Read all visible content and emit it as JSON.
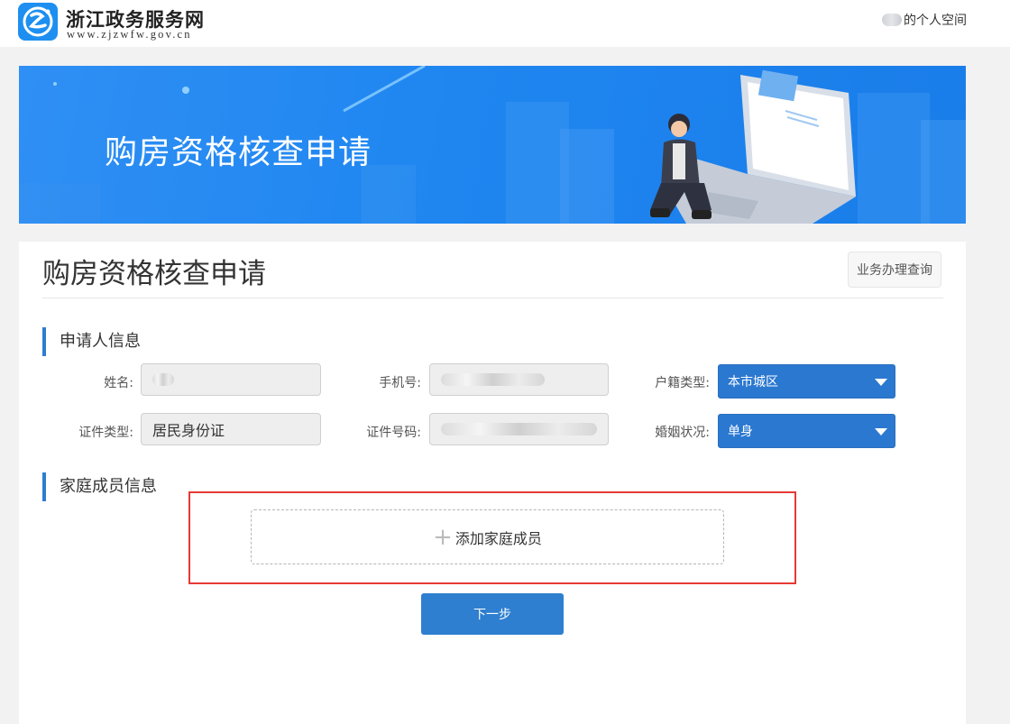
{
  "header": {
    "site_name": "浙江政务服务网",
    "site_url": "www.zjzwfw.gov.cn",
    "user_space_label": "的个人空间"
  },
  "banner": {
    "title": "购房资格核查申请"
  },
  "panel": {
    "title": "购房资格核查申请",
    "query_button": "业务办理查询"
  },
  "applicant_section": {
    "title": "申请人信息",
    "fields": {
      "name_label": "姓名:",
      "phone_label": "手机号:",
      "household_label": "户籍类型:",
      "household_value": "本市城区",
      "id_type_label": "证件类型:",
      "id_type_value": "居民身份证",
      "id_number_label": "证件号码:",
      "marital_label": "婚姻状况:",
      "marital_value": "单身"
    }
  },
  "family_section": {
    "title": "家庭成员信息",
    "add_member_label": "添加家庭成员"
  },
  "actions": {
    "next_label": "下一步"
  },
  "colors": {
    "accent": "#2f7fd0",
    "banner": "#1f86f0",
    "highlight": "#e53935"
  },
  "icons": {
    "logo": "zj-logo-icon",
    "add": "plus-icon",
    "dropdown": "caret-down-icon"
  }
}
